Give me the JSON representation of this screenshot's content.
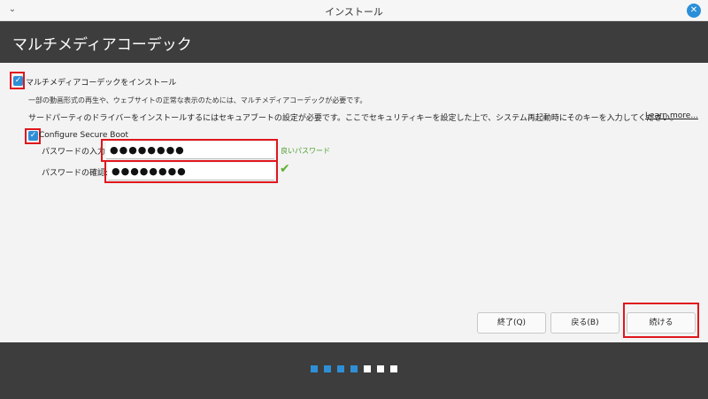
{
  "window": {
    "title": "インストール"
  },
  "header": {
    "title": "マルチメディアコーデック"
  },
  "codecs": {
    "checkbox_label": "マルチメディアコーデックをインストール",
    "description": "一部の動画形式の再生や、ウェブサイトの正常な表示のためには、マルチメディアコーデックが必要です。",
    "checked": true
  },
  "secure_boot": {
    "notice": "サードパーティのドライバーをインストールするにはセキュアブートの設定が必要です。ここでセキュリティキーを設定した上で、システム再起動時にそのキーを入力してください。",
    "learn_more": "Learn more...",
    "checkbox_label": "Configure Secure Boot",
    "checked": true,
    "password_label": "パスワードの入力:",
    "password_value": "●●●●●●●●",
    "strength_text": "良いパスワード",
    "confirm_label": "パスワードの確認:",
    "confirm_value": "●●●●●●●●"
  },
  "buttons": {
    "quit": "終了(Q)",
    "back": "戻る(B)",
    "continue": "続ける"
  },
  "progress": {
    "total_steps": 7,
    "completed_steps": 4
  },
  "colors": {
    "accent": "#2f8fd6",
    "highlight": "#e0161d",
    "dark_bar": "#3d3d3d",
    "step_done": "#2f8fd6",
    "step_todo": "#ffffff"
  }
}
